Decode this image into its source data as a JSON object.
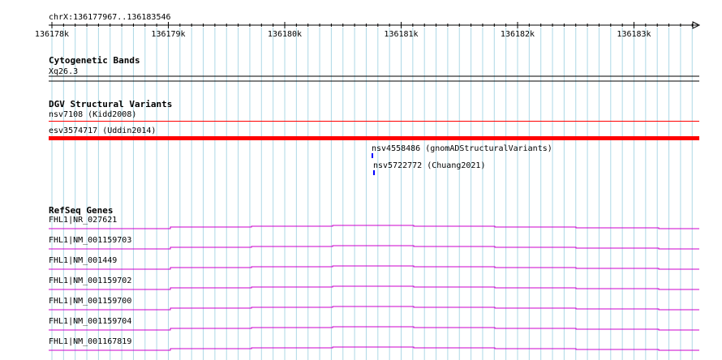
{
  "locus": "chrX:136177967..136183546",
  "ruler": {
    "ticks": [
      "136178k",
      "136179k",
      "136180k",
      "136181k",
      "136182k",
      "136183k"
    ]
  },
  "tracks": {
    "cytoband": {
      "title": "Cytogenetic Bands",
      "band": "Xq26.3"
    },
    "dgv": {
      "title": "DGV Structural Variants",
      "features": [
        {
          "label": "nsv7108 (Kidd2008)",
          "style": "thin-red"
        },
        {
          "label": "esv3574717 (Uddin2014)",
          "style": "thick-red"
        },
        {
          "label": "nsv4558486 (gnomADStructuralVariants)",
          "style": "blue-tick"
        },
        {
          "label": "nsv5722772 (Chuang2021)",
          "style": "blue-tick"
        }
      ]
    },
    "refseq": {
      "title": "RefSeq Genes",
      "transcripts": [
        "FHL1|NR_027621",
        "FHL1|NM_001159703",
        "FHL1|NM_001449",
        "FHL1|NM_001159702",
        "FHL1|NM_001159700",
        "FHL1|NM_001159704",
        "FHL1|NM_001167819"
      ]
    }
  },
  "colors": {
    "grid": "#add8e6",
    "variant_red": "#ff0000",
    "variant_blue": "#0000ff",
    "transcript": "#cc00cc"
  }
}
